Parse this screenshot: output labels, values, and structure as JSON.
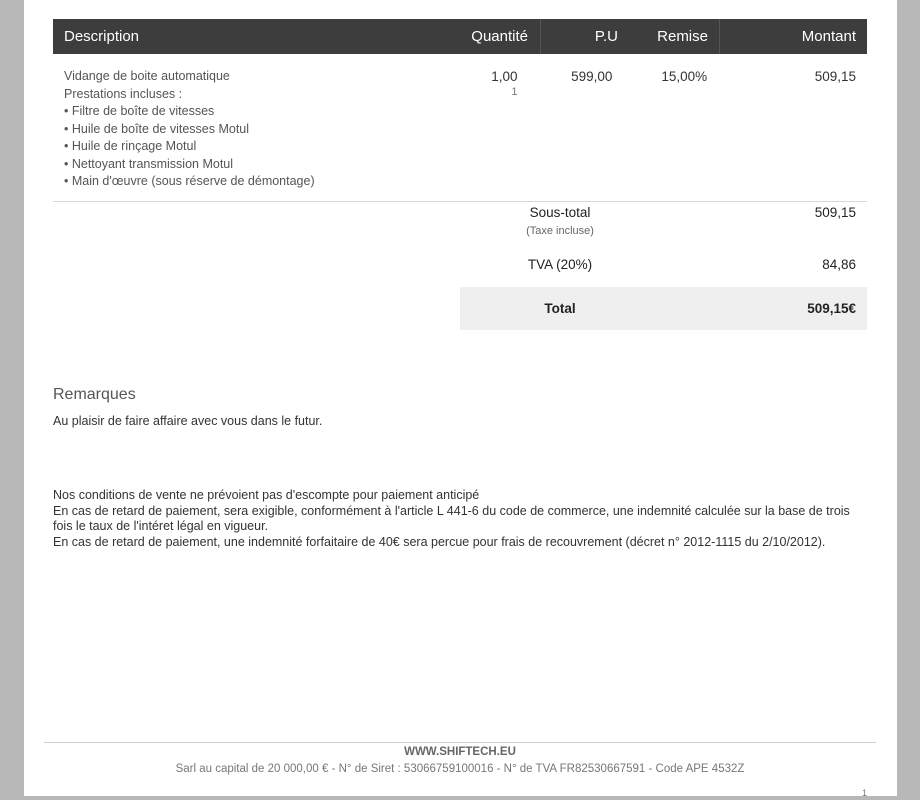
{
  "table": {
    "headers": {
      "description": "Description",
      "quantity": "Quantité",
      "unit_price": "P.U",
      "discount": "Remise",
      "amount": "Montant"
    },
    "rows": [
      {
        "description_lines": [
          "Vidange de boite automatique",
          "Prestations incluses :",
          "• Filtre de boîte de vitesses",
          "• Huile de boîte de vitesses Motul",
          "• Huile de rinçage Motul",
          "• Nettoyant transmission Motul",
          "• Main d'œuvre (sous réserve de démontage)"
        ],
        "quantity": "1,00",
        "quantity_sub": "1",
        "unit_price": "599,00",
        "discount": "15,00%",
        "amount": "509,15"
      }
    ]
  },
  "totals": {
    "subtotal_label": "Sous-total",
    "subtotal_note": "(Taxe incluse)",
    "subtotal_value": "509,15",
    "tva_label": "TVA (20%)",
    "tva_value": "84,86",
    "total_label": "Total",
    "total_value": "509,15€"
  },
  "remarks": {
    "title": "Remarques",
    "text": "Au plaisir de faire affaire avec vous dans le futur."
  },
  "conditions": [
    "Nos conditions de vente ne prévoient pas d'escompte pour paiement anticipé",
    "En cas de retard de paiement, sera exigible, conformément à l'article L 441-6 du code de commerce, une indemnité calculée sur la base de trois fois le taux de l'intéret légal en vigueur.",
    "En cas de retard de paiement, une indemnité forfaitaire de 40€ sera percue pour frais de recouvrement (décret n° 2012-1115 du 2/10/2012)."
  ],
  "footer": {
    "website": "WWW.SHIFTECH.EU",
    "legal": "Sarl au capital de 20 000,00 € - N° de Siret : 53066759100016 - N° de TVA FR82530667591 - Code APE 4532Z",
    "page_number": "1"
  }
}
